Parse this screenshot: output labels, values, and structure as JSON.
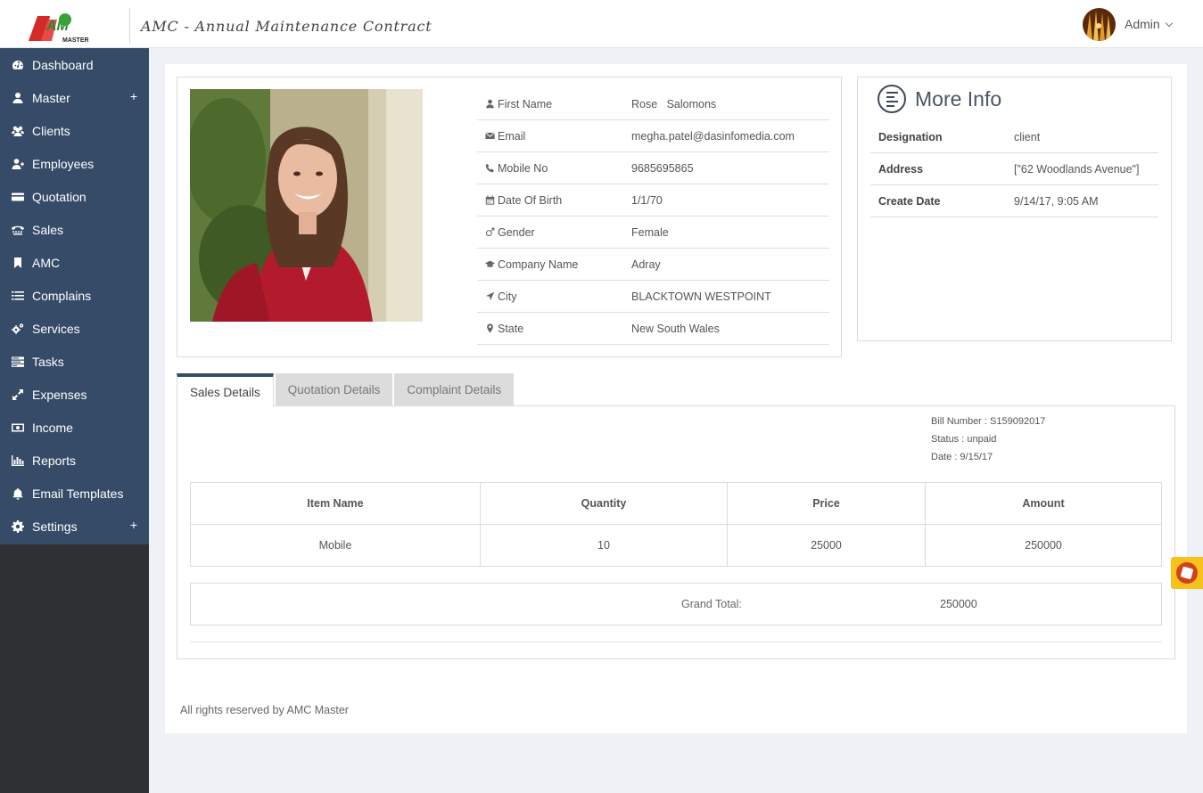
{
  "header": {
    "logo_text": "AMC MASTER",
    "title": "AMC - Annual Maintenance Contract",
    "user": {
      "name": "Admin"
    }
  },
  "sidebar": {
    "items": [
      {
        "label": "Dashboard",
        "icon": "dashboard-icon"
      },
      {
        "label": "Master",
        "icon": "user-icon",
        "expand": "+"
      },
      {
        "label": "Clients",
        "icon": "users-icon"
      },
      {
        "label": "Employees",
        "icon": "user-plus-icon"
      },
      {
        "label": "Quotation",
        "icon": "credit-card-icon"
      },
      {
        "label": "Sales",
        "icon": "tty-icon"
      },
      {
        "label": "AMC",
        "icon": "bookmark-icon"
      },
      {
        "label": "Complains",
        "icon": "list-icon"
      },
      {
        "label": "Services",
        "icon": "cogs-icon"
      },
      {
        "label": "Tasks",
        "icon": "tasks-icon"
      },
      {
        "label": "Expenses",
        "icon": "expand-icon"
      },
      {
        "label": "Income",
        "icon": "money-icon"
      },
      {
        "label": "Reports",
        "icon": "bar-chart-icon"
      },
      {
        "label": "Email Templates",
        "icon": "bell-icon"
      },
      {
        "label": "Settings",
        "icon": "gear-icon",
        "expand": "+"
      }
    ]
  },
  "profile": {
    "fields": [
      {
        "label": "First Name",
        "value": "Rose   Salomons",
        "icon": "user-icon"
      },
      {
        "label": "Email",
        "value": "megha.patel@dasinfomedia.com",
        "icon": "envelope-icon"
      },
      {
        "label": "Mobile No",
        "value": "9685695865",
        "icon": "phone-icon"
      },
      {
        "label": "Date Of Birth",
        "value": "1/1/70",
        "icon": "calendar-icon"
      },
      {
        "label": "Gender",
        "value": "Female",
        "icon": "mars-icon"
      },
      {
        "label": "Company Name",
        "value": "Adray",
        "icon": "graduation-cap-icon"
      },
      {
        "label": "City",
        "value": "BLACKTOWN WESTPOINT",
        "icon": "location-arrow-icon"
      },
      {
        "label": "State",
        "value": "New South Wales",
        "icon": "map-marker-icon"
      }
    ]
  },
  "more_info": {
    "title": "More Info",
    "rows": [
      {
        "label": "Designation",
        "value": "client"
      },
      {
        "label": "Address",
        "value": "[\"62 Woodlands Avenue\"]"
      },
      {
        "label": "Create Date",
        "value": "9/14/17, 9:05 AM"
      }
    ]
  },
  "tabs": [
    {
      "label": "Sales Details",
      "active": true
    },
    {
      "label": "Quotation Details",
      "active": false
    },
    {
      "label": "Complaint Details",
      "active": false
    }
  ],
  "sales": {
    "bill_number_label": "Bill Number : ",
    "bill_number": "S159092017",
    "status_label": "Status : ",
    "status": "unpaid",
    "date_label": "Date : ",
    "date": "9/15/17",
    "columns": [
      "Item Name",
      "Quantity",
      "Price",
      "Amount"
    ],
    "rows": [
      [
        "Mobile",
        "10",
        "25000",
        "250000"
      ]
    ],
    "grand_total_label": "Grand Total:",
    "grand_total": "250000"
  },
  "footer": {
    "text": "All rights reserved by AMC Master"
  },
  "colors": {
    "sidebar_nav": "#364b68",
    "sidebar_bg": "#2f3033",
    "accent": "#364b68",
    "float_button": "#f7c21c"
  }
}
